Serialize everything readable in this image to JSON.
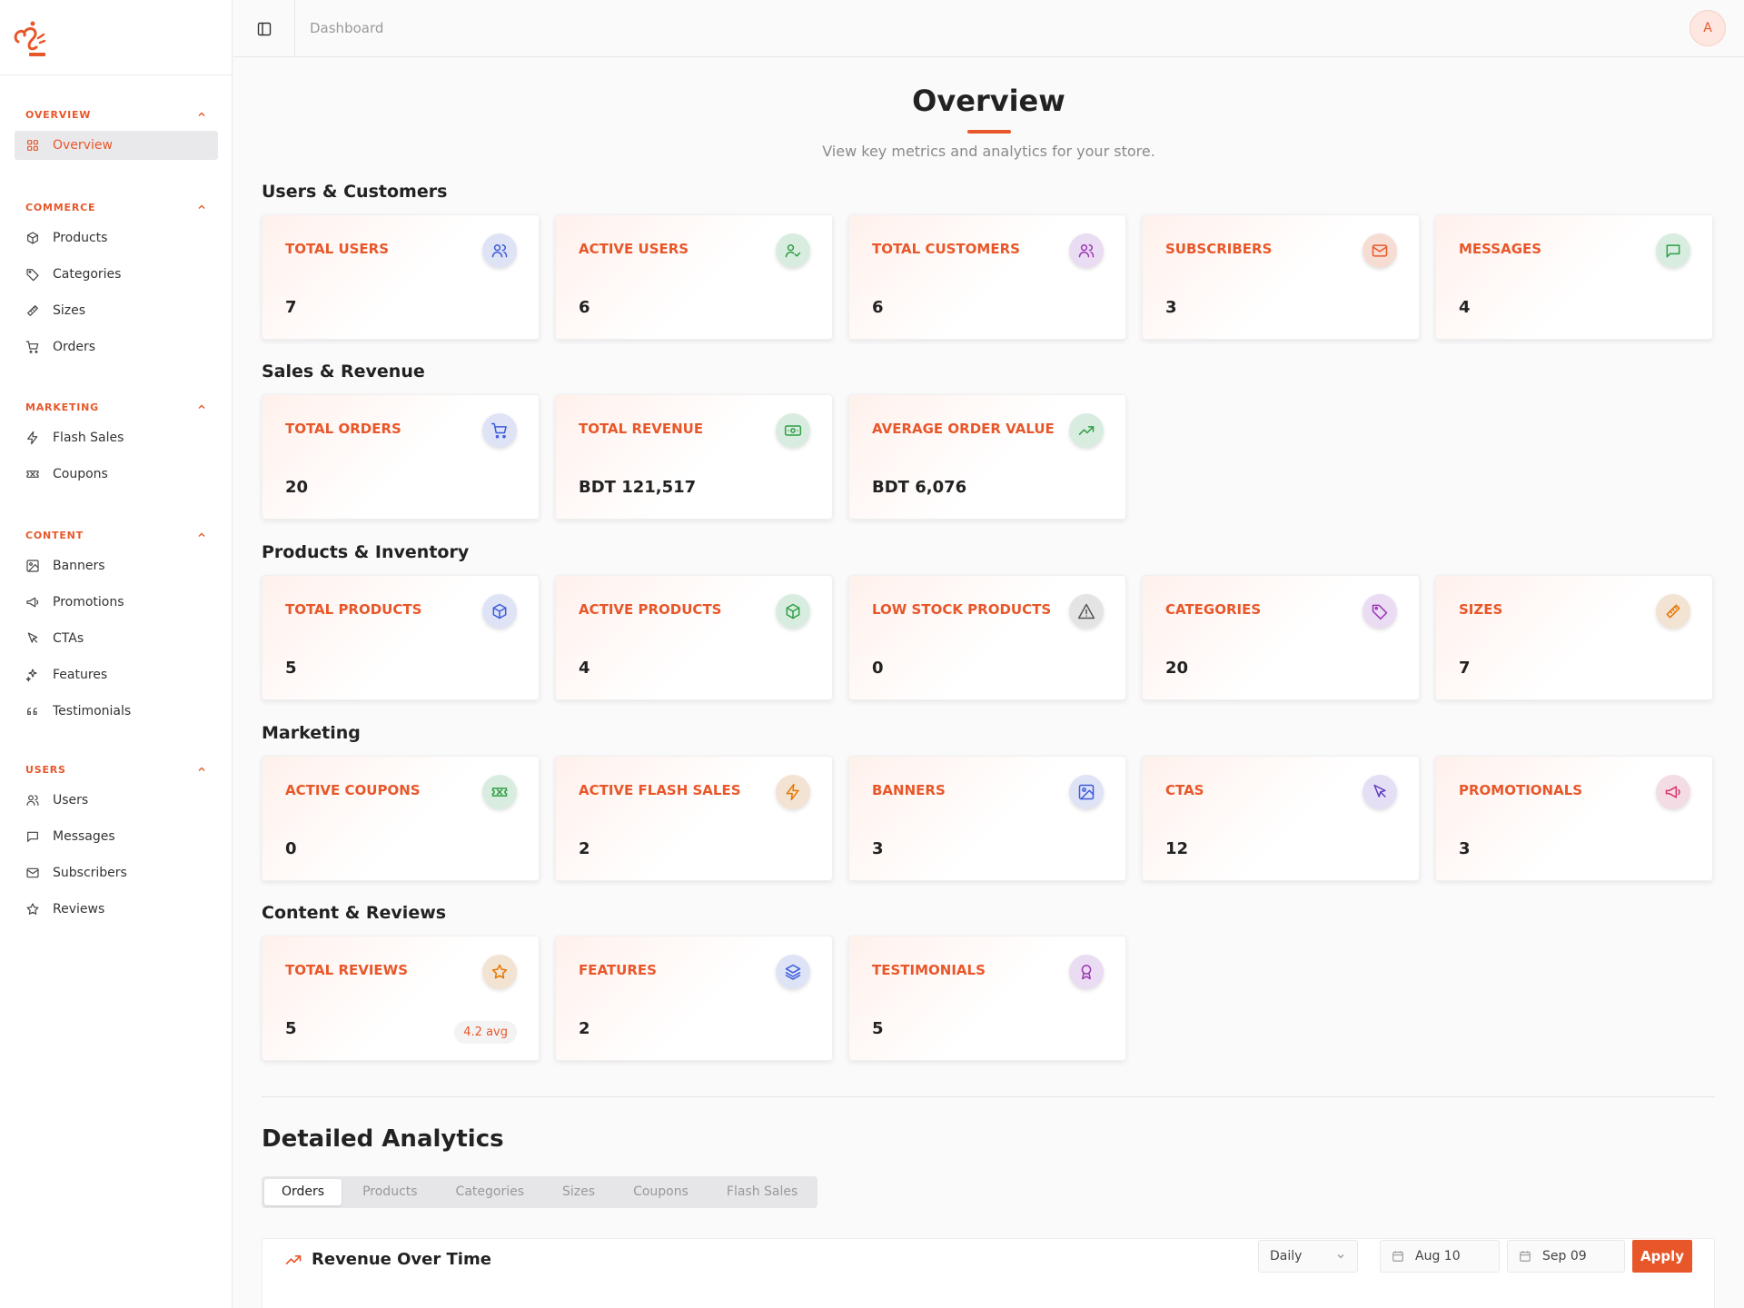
{
  "header": {
    "breadcrumb": "Dashboard",
    "avatar_initial": "A"
  },
  "sidebar": {
    "sections": [
      {
        "title": "OVERVIEW",
        "items": [
          {
            "label": "Overview",
            "icon": "grid-icon",
            "active": true
          }
        ]
      },
      {
        "title": "COMMERCE",
        "items": [
          {
            "label": "Products",
            "icon": "box-icon"
          },
          {
            "label": "Categories",
            "icon": "tag-icon"
          },
          {
            "label": "Sizes",
            "icon": "ruler-icon"
          },
          {
            "label": "Orders",
            "icon": "cart-icon"
          }
        ]
      },
      {
        "title": "MARKETING",
        "items": [
          {
            "label": "Flash Sales",
            "icon": "zap-icon"
          },
          {
            "label": "Coupons",
            "icon": "ticket-icon"
          }
        ]
      },
      {
        "title": "CONTENT",
        "items": [
          {
            "label": "Banners",
            "icon": "image-icon"
          },
          {
            "label": "Promotions",
            "icon": "megaphone-icon"
          },
          {
            "label": "CTAs",
            "icon": "pointer-icon"
          },
          {
            "label": "Features",
            "icon": "sparkles-icon"
          },
          {
            "label": "Testimonials",
            "icon": "quote-icon"
          }
        ]
      },
      {
        "title": "USERS",
        "items": [
          {
            "label": "Users",
            "icon": "users-icon"
          },
          {
            "label": "Messages",
            "icon": "message-icon"
          },
          {
            "label": "Subscribers",
            "icon": "mail-icon"
          },
          {
            "label": "Reviews",
            "icon": "star-icon"
          }
        ]
      }
    ]
  },
  "overview": {
    "title": "Overview",
    "subtitle": "View key metrics and analytics for your store."
  },
  "sections": [
    {
      "title": "Users & Customers",
      "cards": [
        {
          "label": "TOTAL USERS",
          "value": "7",
          "icon": "users-icon",
          "color": "#3b5bdb",
          "bg": "#dfe3f6"
        },
        {
          "label": "ACTIVE USERS",
          "value": "6",
          "icon": "user-check-icon",
          "color": "#2f9e44",
          "bg": "#d8ede0"
        },
        {
          "label": "TOTAL CUSTOMERS",
          "value": "6",
          "icon": "users-icon",
          "color": "#9c36b5",
          "bg": "#eadcf2"
        },
        {
          "label": "SUBSCRIBERS",
          "value": "3",
          "icon": "mail-icon",
          "color": "#e8572a",
          "bg": "#f6ddd4"
        },
        {
          "label": "MESSAGES",
          "value": "4",
          "icon": "message-icon",
          "color": "#2f9e44",
          "bg": "#d8ede0"
        }
      ]
    },
    {
      "title": "Sales & Revenue",
      "cards": [
        {
          "label": "TOTAL ORDERS",
          "value": "20",
          "icon": "cart-icon",
          "color": "#3b5bdb",
          "bg": "#dfe3f6"
        },
        {
          "label": "TOTAL REVENUE",
          "value": "BDT 121,517",
          "icon": "banknote-icon",
          "color": "#2f9e44",
          "bg": "#d8ede0"
        },
        {
          "label": "AVERAGE ORDER VALUE",
          "value": "BDT 6,076",
          "icon": "trending-up-icon",
          "color": "#2f9e44",
          "bg": "#d8ede0"
        }
      ]
    },
    {
      "title": "Products & Inventory",
      "cards": [
        {
          "label": "TOTAL PRODUCTS",
          "value": "5",
          "icon": "box-icon",
          "color": "#3b5bdb",
          "bg": "#dfe3f6"
        },
        {
          "label": "ACTIVE PRODUCTS",
          "value": "4",
          "icon": "box-icon",
          "color": "#2f9e44",
          "bg": "#d8ede0"
        },
        {
          "label": "LOW STOCK PRODUCTS",
          "value": "0",
          "icon": "alert-triangle-icon",
          "color": "#555555",
          "bg": "#e4e4e4"
        },
        {
          "label": "CATEGORIES",
          "value": "20",
          "icon": "tag-icon",
          "color": "#9c36b5",
          "bg": "#eadcf2"
        },
        {
          "label": "SIZES",
          "value": "7",
          "icon": "ruler-icon",
          "color": "#e67700",
          "bg": "#f3e3d2"
        }
      ]
    },
    {
      "title": "Marketing",
      "cards": [
        {
          "label": "ACTIVE COUPONS",
          "value": "0",
          "icon": "ticket-icon",
          "color": "#2f9e44",
          "bg": "#d8ede0"
        },
        {
          "label": "ACTIVE FLASH SALES",
          "value": "2",
          "icon": "zap-icon",
          "color": "#e67700",
          "bg": "#f3e3d2"
        },
        {
          "label": "BANNERS",
          "value": "3",
          "icon": "image-icon",
          "color": "#3b5bdb",
          "bg": "#dfe3f6"
        },
        {
          "label": "CTAS",
          "value": "12",
          "icon": "pointer-icon",
          "color": "#5f3dc4",
          "bg": "#e4dff4"
        },
        {
          "label": "PROMOTIONALS",
          "value": "3",
          "icon": "megaphone-icon",
          "color": "#d6336c",
          "bg": "#f4dce4"
        }
      ]
    },
    {
      "title": "Content & Reviews",
      "cards": [
        {
          "label": "TOTAL REVIEWS",
          "value": "5",
          "badge": "4.2 avg",
          "icon": "star-icon",
          "color": "#e67700",
          "bg": "#f3e3d2"
        },
        {
          "label": "FEATURES",
          "value": "2",
          "icon": "layers-icon",
          "color": "#3b5bdb",
          "bg": "#dfe3f6"
        },
        {
          "label": "TESTIMONIALS",
          "value": "5",
          "icon": "award-icon",
          "color": "#9c36b5",
          "bg": "#eadcf2"
        }
      ]
    }
  ],
  "analytics": {
    "title": "Detailed Analytics",
    "tabs": [
      "Orders",
      "Products",
      "Categories",
      "Sizes",
      "Coupons",
      "Flash Sales"
    ],
    "active_tab": "Orders",
    "chart_title": "Revenue Over Time",
    "interval": "Daily",
    "date_from": "Aug 10",
    "date_to": "Sep 09",
    "apply_label": "Apply"
  },
  "colors": {
    "accent": "#e8572a"
  }
}
